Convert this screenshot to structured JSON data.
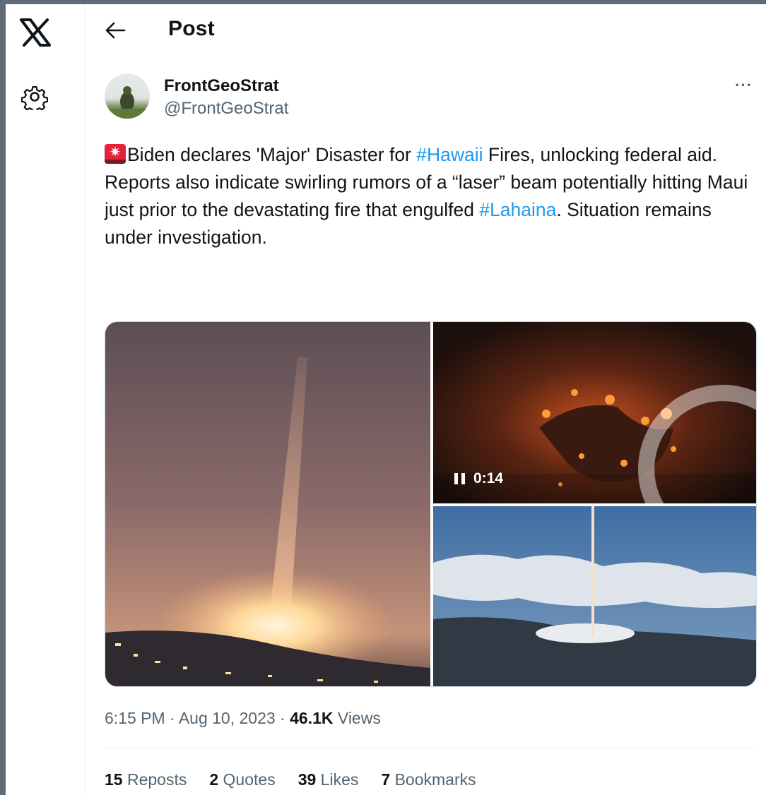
{
  "header": {
    "title": "Post"
  },
  "post": {
    "display_name": "FrontGeoStrat",
    "handle": "@FrontGeoStrat",
    "more_label": "···",
    "text": {
      "siren_glyph": "✷",
      "part1": "Biden declares 'Major' Disaster for ",
      "hashtag1": "#Hawaii",
      "part2": " Fires, unlocking federal aid. Reports also indicate swirling rumors of a “laser” beam potentially hitting Maui just prior to the devastating fire that engulfed ",
      "hashtag2": "#Lahaina",
      "part3": ". Situation remains under investigation."
    },
    "video": {
      "duration": "0:14"
    },
    "meta": {
      "time": "6:15 PM",
      "sep1": " · ",
      "date": "Aug 10, 2023",
      "sep2": " · ",
      "views_count": "46.1K",
      "views_label": " Views"
    },
    "stats": {
      "reposts_count": "15",
      "reposts_label": " Reposts",
      "quotes_count": "2",
      "quotes_label": " Quotes",
      "likes_count": "39",
      "likes_label": " Likes",
      "bookmarks_count": "7",
      "bookmarks_label": " Bookmarks"
    }
  },
  "colors": {
    "accent": "#1d9bf0",
    "text": "#0f1419",
    "secondary": "#536471"
  },
  "icons": [
    "x-logo-icon",
    "gear-icon",
    "back-arrow-icon",
    "more-icon",
    "siren-icon",
    "pause-icon",
    "loading-spinner-icon"
  ]
}
